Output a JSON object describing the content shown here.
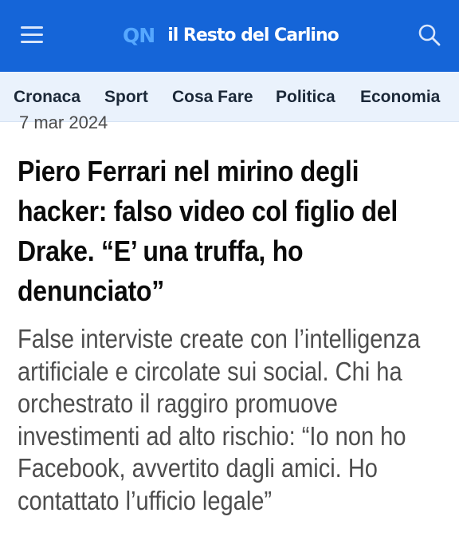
{
  "header": {
    "brand_short": "QN",
    "brand_name": "il Resto del Carlino",
    "menu_icon": "hamburger-menu-icon",
    "search_icon": "search-icon",
    "background_color": "#1565d8",
    "brand_short_color": "#56a8ff"
  },
  "nav": {
    "items": [
      {
        "label": "Cronaca"
      },
      {
        "label": "Sport"
      },
      {
        "label": "Cosa Fare"
      },
      {
        "label": "Politica"
      },
      {
        "label": "Economia"
      }
    ],
    "background_color": "#eaf2fc"
  },
  "article": {
    "date": "7 mar 2024",
    "headline": "Piero Ferrari nel mirino degli hacker: falso video col figlio del Drake. “E’ una truffa, ho denunciato”",
    "summary": "False interviste create con l’intelligenza artificiale e circolate sui social. Chi ha orchestrato il raggiro promuove investimenti ad alto rischio: “Io non ho Facebook, avvertito dagli amici. Ho contattato l’ufficio legale”"
  }
}
